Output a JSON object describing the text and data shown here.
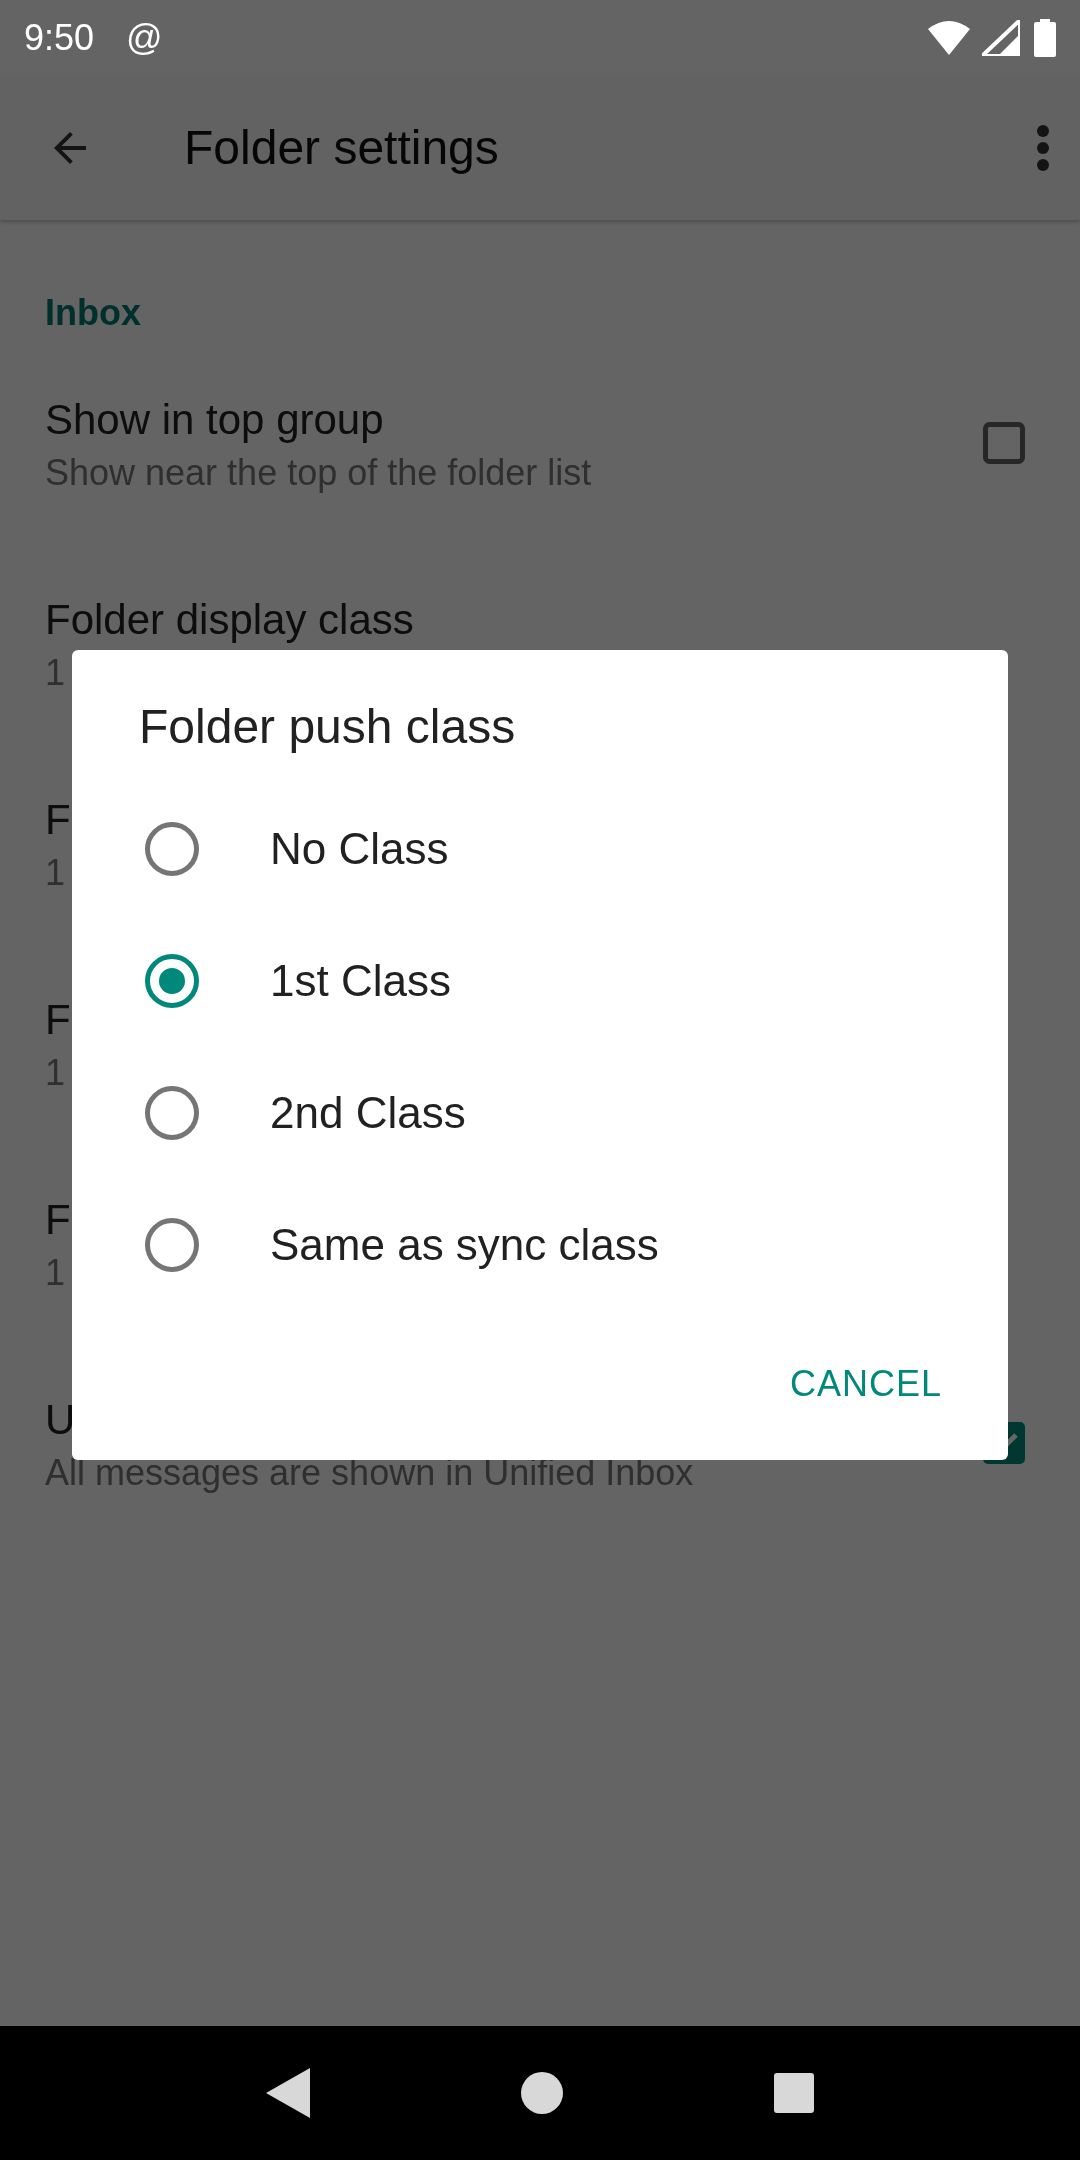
{
  "status_bar": {
    "time": "9:50",
    "notification": "@"
  },
  "app_bar": {
    "title": "Folder settings"
  },
  "category": "Inbox",
  "rows": [
    {
      "title": "Show in top group",
      "summary": "Show near the top of the folder list",
      "checked": false
    },
    {
      "title": "Folder display class",
      "summary": "1"
    },
    {
      "title": "F",
      "summary": "1"
    },
    {
      "title": "F",
      "summary": "1"
    },
    {
      "title": "F",
      "summary": "1"
    },
    {
      "title": "U",
      "summary": "All messages are shown in Unified Inbox",
      "checked": true
    }
  ],
  "dialog": {
    "title": "Folder push class",
    "options": [
      {
        "label": "No Class",
        "selected": false
      },
      {
        "label": "1st Class",
        "selected": true
      },
      {
        "label": "2nd Class",
        "selected": false
      },
      {
        "label": "Same as sync class",
        "selected": false
      }
    ],
    "buttons": [
      "CANCEL"
    ]
  }
}
